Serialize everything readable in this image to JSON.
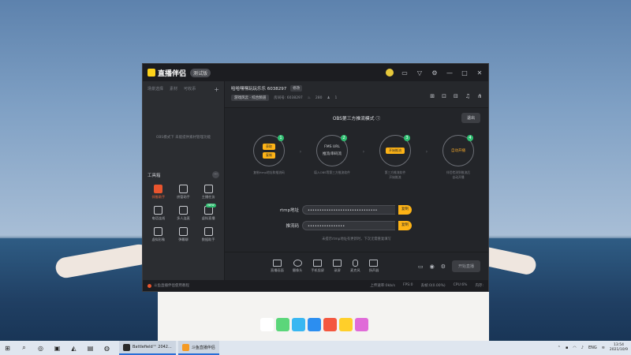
{
  "desktop": {
    "dock_colors": [
      "#ffffff",
      "#5bd67a",
      "#38b7f2",
      "#2c8ef0",
      "#f4573f",
      "#ffcf2a",
      "#e06bd8"
    ]
  },
  "window": {
    "app_name": "直播伴侣",
    "version_label": "测试版",
    "title_icons": [
      "avatar-icon",
      "message-icon",
      "shirt-icon",
      "settings-icon",
      "minimize-icon",
      "maximize-icon",
      "close-icon"
    ]
  },
  "left_panel": {
    "tabs": [
      "场景选择",
      "素材",
      "可收添"
    ],
    "plus": "+",
    "hint": "OBS模式下 未能提供素材管理功能",
    "tools_title": "工具箱",
    "tools_more": "···",
    "tools": [
      {
        "label": "伴推助手",
        "badge": "",
        "active": true
      },
      {
        "label": "房管助手",
        "badge": "",
        "active": false
      },
      {
        "label": "主播任务",
        "badge": "",
        "active": false
      },
      {
        "label": "电话连线",
        "badge": "",
        "active": false
      },
      {
        "label": "多人连麦",
        "badge": "",
        "active": false
      },
      {
        "label": "虚拟直播",
        "badge": "NEW",
        "active": false
      },
      {
        "label": "虚拟形象",
        "badge": "",
        "active": false
      },
      {
        "label": "弹幕聊",
        "badge": "",
        "active": false
      },
      {
        "label": "数据助手",
        "badge": "",
        "active": false
      }
    ]
  },
  "room": {
    "title": "哈哈嘿嘿玩玩乐乐 6038297",
    "edit_label": "修改",
    "category": "游戏风云 · 综合频道",
    "id_label": "房间号: 6038297",
    "fans": "280",
    "viewers": "1"
  },
  "stream": {
    "mode_title": "OBS第三方推流模式",
    "exit_label": "退出",
    "steps": [
      {
        "num": "1",
        "lines": [
          "获取",
          "复制"
        ],
        "caption": "复制rtmp地址和推流码"
      },
      {
        "num": "2",
        "lines": [
          "FMS URL",
          "推流/串码流"
        ],
        "caption": "填入OBS等第三方推流软件"
      },
      {
        "num": "3",
        "lines": [
          "开始推流"
        ],
        "caption": "第三方推流软件\n开始推流"
      },
      {
        "num": "4",
        "lines": [
          "自动开播"
        ],
        "caption": "伴侣检测到推流后\n自动开播"
      }
    ],
    "rtmp_label": "rtmp地址",
    "rtmp_value": "••••••••••••••••••••••••••••••",
    "key_label": "推流码",
    "key_value": "••••••••••••••••",
    "copy_label": "复制",
    "note": "未提示rtmp地址有更新时，下次无需重复填写"
  },
  "bottom_tools": [
    "直播画面",
    "摄像头",
    "手机投屏",
    "录屏",
    "麦克风",
    "扬声器"
  ],
  "bottom_start": "开始直播",
  "statusbar": {
    "notice": "斗鱼直播伴侣使用教程",
    "stats": [
      "上传速率:0kb/s",
      "FPS:0",
      "丢帧:0(0.00%)",
      "CPU:6%",
      "内存:"
    ]
  },
  "taskbar": {
    "apps": [
      {
        "label": "Battlefield™ 2042...",
        "color": "#2a2a2a"
      },
      {
        "label": "斗鱼直播伴侣",
        "color": "#f59a23"
      }
    ],
    "lang": "ENG",
    "time": "13:54",
    "date": "2021/10/9"
  }
}
